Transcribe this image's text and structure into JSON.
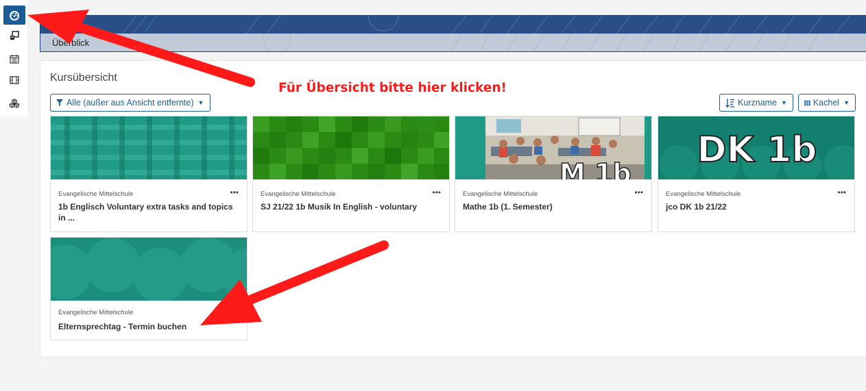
{
  "sidebar": {
    "items": [
      {
        "icon": "dashboard-icon",
        "active": true
      },
      {
        "icon": "site-home-icon"
      },
      {
        "icon": "calendar-icon"
      },
      {
        "icon": "film-icon"
      },
      {
        "icon": "cubes-icon"
      }
    ]
  },
  "header": {
    "breadcrumb": "Überblick",
    "banner_color": "#2a4f86"
  },
  "overview": {
    "title": "Kursübersicht",
    "filter_label": "Alle (außer aus Ansicht entfernte)",
    "sort_label": "Kurzname",
    "view_label": "Kachel",
    "accent": "#1b5c96"
  },
  "courses": [
    {
      "category": "Evangelische Mittelschule",
      "name": "1b Englisch Voluntary extra tasks and topics in ...",
      "menu": "•••"
    },
    {
      "category": "Evangelische Mittelschule",
      "name": "SJ 21/22 1b Musik In English - voluntary",
      "menu": "•••"
    },
    {
      "category": "Evangelische Mittelschule",
      "name": "Mathe 1b (1. Semester)",
      "menu": "•••",
      "image_text": "M 1b"
    },
    {
      "category": "Evangelische Mittelschule",
      "name": "jco DK 1b 21/22",
      "menu": "•••",
      "image_text": "DK 1b"
    },
    {
      "category": "Evangelische Mittelschule",
      "name": "Elternsprechtag - Termin buchen",
      "menu": ""
    }
  ],
  "annotation": {
    "text": "Für Übersicht bitte hier klicken!",
    "color": "#ff1a1a"
  }
}
